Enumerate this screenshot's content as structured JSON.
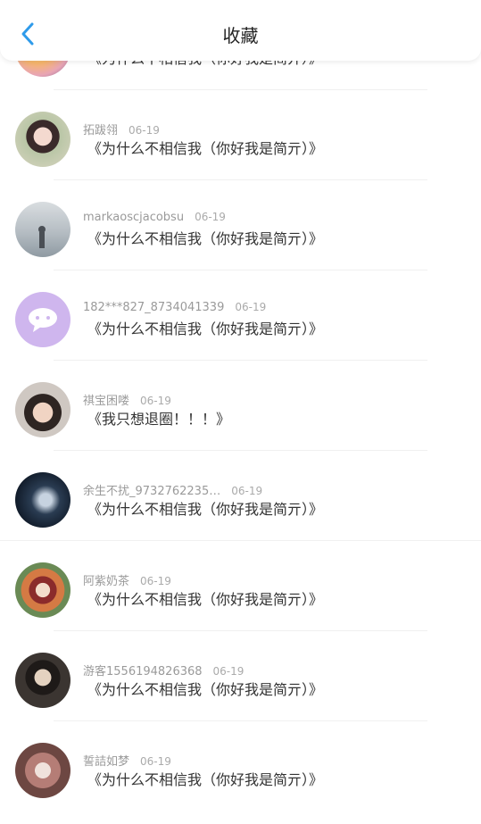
{
  "header": {
    "title": "收藏"
  },
  "items": [
    {
      "name": "",
      "date": "",
      "content": "《为什么不相信我（你好我是简亓）》"
    },
    {
      "name": "拓跋翎",
      "date": "06-19",
      "content": "《为什么不相信我（你好我是简亓）》"
    },
    {
      "name": "markaoscjacobsu",
      "date": "06-19",
      "content": "《为什么不相信我（你好我是简亓）》"
    },
    {
      "name": "182***827_8734041339",
      "date": "06-19",
      "content": "《为什么不相信我（你好我是简亓）》"
    },
    {
      "name": "祺宝困喽",
      "date": "06-19",
      "content": "《我只想退圈！！！》"
    },
    {
      "name": "余生不扰_9732762235…",
      "date": "06-19",
      "content": "《为什么不相信我（你好我是简亓）》"
    },
    {
      "name": "阿紫奶茶",
      "date": "06-19",
      "content": "《为什么不相信我（你好我是简亓）》"
    },
    {
      "name": "游客1556194826368",
      "date": "06-19",
      "content": "《为什么不相信我（你好我是简亓）》"
    },
    {
      "name": "誓詰如梦",
      "date": "06-19",
      "content": "《为什么不相信我（你好我是简亓）》"
    }
  ]
}
